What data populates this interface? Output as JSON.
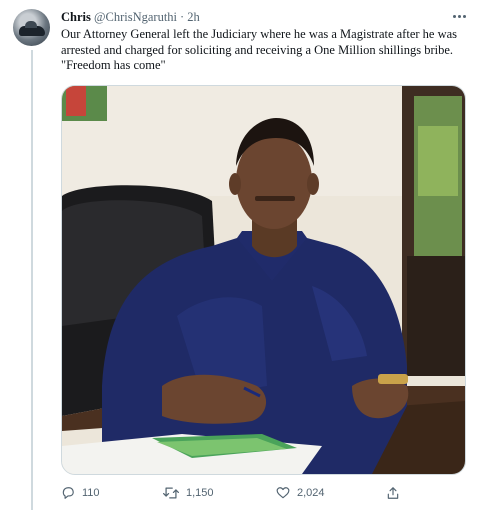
{
  "tweet": {
    "author_name": "Chris",
    "author_handle": "@ChrisNgaruthi",
    "separator": "·",
    "time": "2h",
    "text_lines": [
      "Our Attorney General left the Judiciary where he was a Magistrate after he was",
      "arrested and charged for soliciting and receiving a One Million shillings bribe.",
      "\"Freedom has come\""
    ],
    "media_icon": "photo-man-in-blue-shirt-at-desk",
    "replies": "110",
    "retweets": "1,150",
    "likes": "2,024"
  },
  "icons": {
    "more": "more-horizontal-icon",
    "reply": "reply-icon",
    "retweet": "retweet-icon",
    "like": "heart-icon",
    "share": "share-icon"
  },
  "colors": {
    "secondary_text": "#536471",
    "border": "#cfd9de"
  }
}
